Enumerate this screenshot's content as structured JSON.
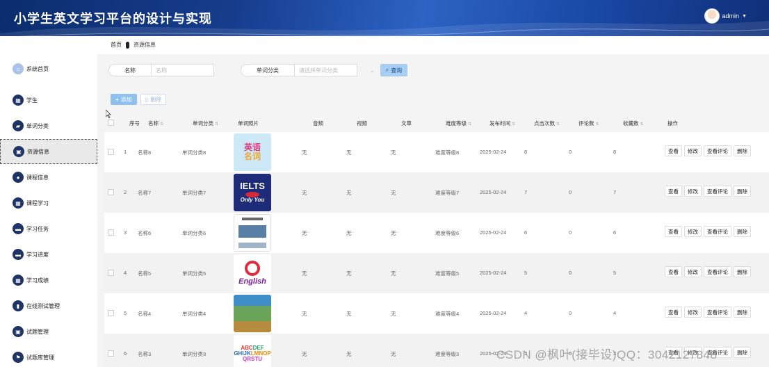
{
  "header": {
    "title": "小学生英文学习平台的设计与实现",
    "username": "admin"
  },
  "breadcrumb": {
    "home": "首页",
    "current": "资源信息"
  },
  "sidebar": {
    "items": [
      {
        "label": "系统首页",
        "icon": "home-icon"
      },
      {
        "label": "学生",
        "icon": "grid-icon"
      },
      {
        "label": "单词分类",
        "icon": "car-icon"
      },
      {
        "label": "资源信息",
        "icon": "bag-icon",
        "active": true
      },
      {
        "label": "课程信息",
        "icon": "person-icon"
      },
      {
        "label": "课程学习",
        "icon": "grid-icon"
      },
      {
        "label": "学习任务",
        "icon": "chat-icon"
      },
      {
        "label": "学习进度",
        "icon": "chat-icon"
      },
      {
        "label": "学习成绩",
        "icon": "grid-icon"
      },
      {
        "label": "在线测试管理",
        "icon": "bar-chart-icon"
      },
      {
        "label": "试题管理",
        "icon": "bag-icon"
      },
      {
        "label": "试题库管理",
        "icon": "flag-icon"
      }
    ]
  },
  "search": {
    "name_label": "名称",
    "name_placeholder": "名称",
    "category_label": "单词分类",
    "category_placeholder": "请选择单词分类",
    "search_button": "查询"
  },
  "toolbar": {
    "add": "添加",
    "delete": "删除"
  },
  "table": {
    "headers": [
      "序号",
      "名称",
      "单词分类",
      "单词照片",
      "音频",
      "视频",
      "文章",
      "难度等级",
      "发布时间",
      "点击次数",
      "评论数",
      "收藏数",
      "操作"
    ],
    "row_actions": [
      "查看",
      "修改",
      "查看评论",
      "删除"
    ],
    "rows": [
      {
        "no": "1",
        "name": "名称8",
        "category": "单词分类8",
        "photo": "英语名词",
        "audio": "无",
        "video": "无",
        "article": "无",
        "level": "难度等级8",
        "date": "2025-02-24",
        "clicks": "8",
        "comments": "0",
        "favorites": "8"
      },
      {
        "no": "2",
        "name": "名称7",
        "category": "单词分类7",
        "photo": "IELTS",
        "audio": "无",
        "video": "无",
        "article": "无",
        "level": "难度等级7",
        "date": "2025-02-24",
        "clicks": "7",
        "comments": "0",
        "favorites": "7"
      },
      {
        "no": "3",
        "name": "名称6",
        "category": "单词分类6",
        "photo": "",
        "audio": "无",
        "video": "无",
        "article": "无",
        "level": "难度等级6",
        "date": "2025-02-24",
        "clicks": "6",
        "comments": "0",
        "favorites": "6"
      },
      {
        "no": "4",
        "name": "名称5",
        "category": "单词分类5",
        "photo": "English",
        "audio": "无",
        "video": "无",
        "article": "无",
        "level": "难度等级5",
        "date": "2025-02-24",
        "clicks": "5",
        "comments": "0",
        "favorites": "5"
      },
      {
        "no": "5",
        "name": "名称4",
        "category": "单词分类4",
        "photo": "",
        "audio": "无",
        "video": "无",
        "article": "无",
        "level": "难度等级4",
        "date": "2025-02-24",
        "clicks": "4",
        "comments": "0",
        "favorites": "4"
      },
      {
        "no": "6",
        "name": "名称3",
        "category": "单词分类3",
        "photo": "ABCDEFG",
        "audio": "无",
        "video": "无",
        "article": "无",
        "level": "难度等级3",
        "date": "2025-02-24",
        "clicks": "3",
        "comments": "0",
        "favorites": "3"
      }
    ]
  },
  "watermark": "CSDN @枫叶(接毕设)QQ：3042127848",
  "colors": {
    "header_bg": "#163c8c",
    "sidebar_icon": "#1f3466",
    "search_button": "#a8cff2",
    "add_button": "#8ec0f0"
  }
}
